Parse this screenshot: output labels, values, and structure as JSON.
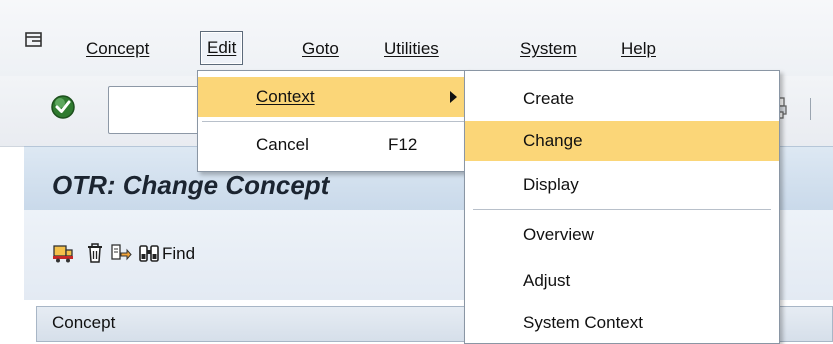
{
  "menubar": {
    "items": [
      {
        "label": "Concept"
      },
      {
        "label": "Edit"
      },
      {
        "label": "Goto"
      },
      {
        "label": "Utilities"
      },
      {
        "label": "System"
      },
      {
        "label": "Help"
      }
    ]
  },
  "toolbar": {
    "command_value": ""
  },
  "title": "OTR: Change Concept",
  "apptoolbar": {
    "find_label": "Find"
  },
  "concept_header": "Concept",
  "edit_menu": {
    "items": [
      {
        "label": "Context",
        "shortcut": ""
      },
      {
        "label": "Cancel",
        "shortcut": "F12"
      }
    ]
  },
  "context_submenu": {
    "items": [
      {
        "label": "Create"
      },
      {
        "label": "Change"
      },
      {
        "label": "Display"
      },
      {
        "label": "Overview"
      },
      {
        "label": "Adjust"
      },
      {
        "label": "System Context"
      }
    ]
  },
  "colors": {
    "highlight": "#fbd678",
    "title_bar": "#c9d9ea"
  }
}
